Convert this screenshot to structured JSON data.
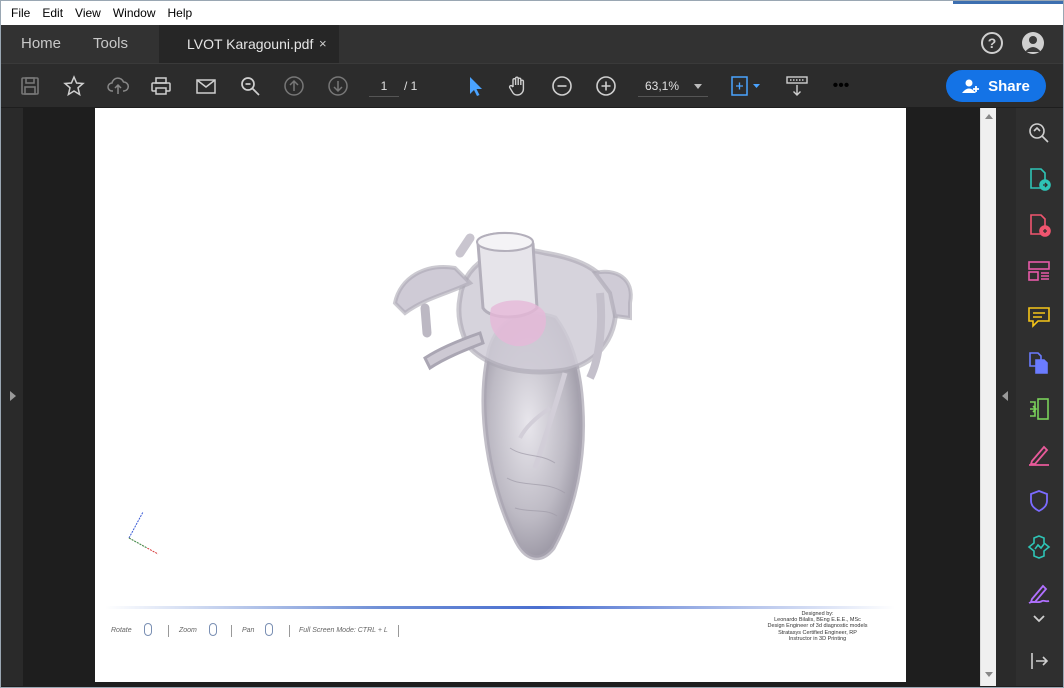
{
  "menu": [
    "File",
    "Edit",
    "View",
    "Window",
    "Help"
  ],
  "tabs": {
    "home": "Home",
    "tools": "Tools",
    "document": "LVOT Karagouni.pdf",
    "close": "×"
  },
  "toolbar": {
    "page_current": "1",
    "page_total": "/ 1",
    "zoom": "63,1%",
    "share_label": "Share",
    "more": "•••"
  },
  "icons": {
    "toolbar": [
      "save-icon",
      "bookmark-star-icon",
      "upload-cloud-icon",
      "print-icon",
      "email-icon",
      "find-zoom-icon",
      "previous-page-icon",
      "next-page-icon",
      "select-arrow-icon",
      "hand-icon",
      "zoom-out-icon",
      "zoom-in-icon",
      "fit-page-icon",
      "scroll-mode-icon",
      "more-icon"
    ],
    "right_panel": [
      "zoom-panel-icon",
      "export-pdf-icon",
      "create-pdf-icon",
      "organize-pages-icon",
      "comment-icon",
      "combine-files-icon",
      "compress-icon",
      "fill-sign-icon",
      "protect-icon",
      "send-for-signature-icon",
      "request-signature-icon",
      "collapse-icon",
      "exit-panel-icon"
    ]
  },
  "colors": {
    "accent": "#1473e6",
    "select_tool": "#4aa3ff"
  },
  "document": {
    "controls": [
      {
        "label": "Rotate"
      },
      {
        "label": "Zoom"
      },
      {
        "label": "Pan"
      },
      {
        "label": "Full Screen Mode:  CTRL + L"
      }
    ],
    "credits": [
      "Designed by:",
      "Leonardo Bilalis, BEng E.E.E., MSc",
      "Design Engineer of 3d diagnostic models",
      "Stratasys Certified Engineer, RP",
      "Instructor in 3D Printing"
    ]
  }
}
